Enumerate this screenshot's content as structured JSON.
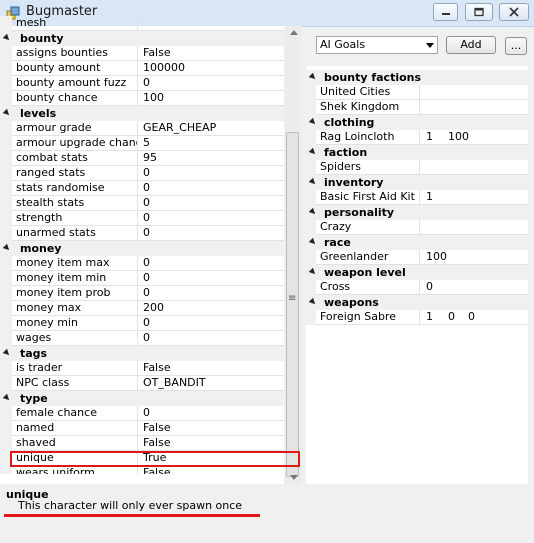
{
  "window": {
    "title": "Bugmaster"
  },
  "property_grid": {
    "rows": [
      {
        "type": "row",
        "name": "mesh",
        "value": ""
      },
      {
        "type": "cat",
        "name": "bounty"
      },
      {
        "type": "row",
        "name": "assigns bounties",
        "value": "False"
      },
      {
        "type": "row",
        "name": "bounty amount",
        "value": "100000"
      },
      {
        "type": "row",
        "name": "bounty amount fuzz",
        "value": "0"
      },
      {
        "type": "row",
        "name": "bounty chance",
        "value": "100"
      },
      {
        "type": "cat",
        "name": "levels"
      },
      {
        "type": "row",
        "name": "armour grade",
        "value": "GEAR_CHEAP"
      },
      {
        "type": "row",
        "name": "armour upgrade chance",
        "value": "5"
      },
      {
        "type": "row",
        "name": "combat stats",
        "value": "95"
      },
      {
        "type": "row",
        "name": "ranged stats",
        "value": "0"
      },
      {
        "type": "row",
        "name": "stats randomise",
        "value": "0"
      },
      {
        "type": "row",
        "name": "stealth stats",
        "value": "0"
      },
      {
        "type": "row",
        "name": "strength",
        "value": "0"
      },
      {
        "type": "row",
        "name": "unarmed stats",
        "value": "0"
      },
      {
        "type": "cat",
        "name": "money"
      },
      {
        "type": "row",
        "name": "money item max",
        "value": "0"
      },
      {
        "type": "row",
        "name": "money item min",
        "value": "0"
      },
      {
        "type": "row",
        "name": "money item prob",
        "value": "0"
      },
      {
        "type": "row",
        "name": "money max",
        "value": "200"
      },
      {
        "type": "row",
        "name": "money min",
        "value": "0"
      },
      {
        "type": "row",
        "name": "wages",
        "value": "0"
      },
      {
        "type": "cat",
        "name": "tags"
      },
      {
        "type": "row",
        "name": "is trader",
        "value": "False"
      },
      {
        "type": "row",
        "name": "NPC class",
        "value": "OT_BANDIT"
      },
      {
        "type": "cat",
        "name": "type"
      },
      {
        "type": "row",
        "name": "female chance",
        "value": "0"
      },
      {
        "type": "row",
        "name": "named",
        "value": "False"
      },
      {
        "type": "row",
        "name": "shaved",
        "value": "False"
      },
      {
        "type": "row",
        "name": "unique",
        "value": "True"
      },
      {
        "type": "row",
        "name": "wears uniform",
        "value": "False"
      }
    ]
  },
  "description": {
    "title": "unique",
    "text": "This character will only ever spawn once"
  },
  "toolbar": {
    "select_value": "AI Goals",
    "add_label": "Add",
    "more_label": "..."
  },
  "reference_grid": {
    "rows": [
      {
        "type": "cat",
        "name": "bounty factions"
      },
      {
        "type": "row",
        "name": "United Cities",
        "values": []
      },
      {
        "type": "row",
        "name": "Shek Kingdom",
        "values": []
      },
      {
        "type": "cat",
        "name": "clothing"
      },
      {
        "type": "row",
        "name": "Rag Loincloth",
        "values": [
          "1",
          "100"
        ]
      },
      {
        "type": "cat",
        "name": "faction"
      },
      {
        "type": "row",
        "name": "Spiders",
        "values": []
      },
      {
        "type": "cat",
        "name": "inventory"
      },
      {
        "type": "row",
        "name": "Basic First Aid Kit",
        "values": [
          "1"
        ]
      },
      {
        "type": "cat",
        "name": "personality"
      },
      {
        "type": "row",
        "name": "Crazy",
        "values": []
      },
      {
        "type": "cat",
        "name": "race"
      },
      {
        "type": "row",
        "name": "Greenlander",
        "values": [
          "100"
        ]
      },
      {
        "type": "cat",
        "name": "weapon level"
      },
      {
        "type": "row",
        "name": "Cross",
        "values": [
          "0"
        ]
      },
      {
        "type": "cat",
        "name": "weapons"
      },
      {
        "type": "row",
        "name": "Foreign Sabre",
        "values": [
          "1",
          "0",
          "0"
        ]
      }
    ]
  },
  "colors": {
    "accent_red": "#e01818",
    "titlebar": "#d8e6f5"
  }
}
